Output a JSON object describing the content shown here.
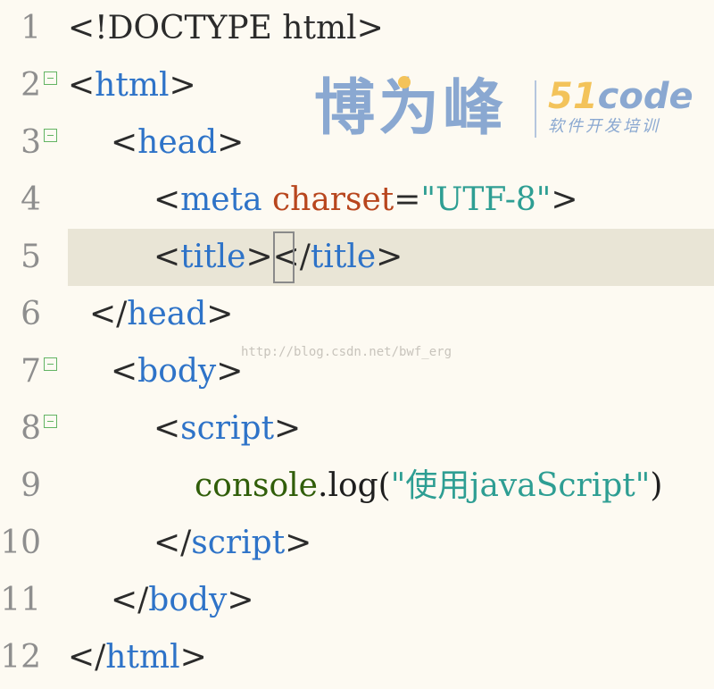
{
  "lines": [
    {
      "num": "1",
      "tokens": [
        "<!DOCTYPE",
        " html>"
      ]
    },
    {
      "num": "2",
      "tokens": [
        "<",
        "html",
        ">"
      ]
    },
    {
      "num": "3",
      "tokens": [
        "<",
        "head",
        ">"
      ]
    },
    {
      "num": "4",
      "tokens": [
        "<",
        "meta",
        " charset",
        "=",
        "\"UTF-8\"",
        ">"
      ]
    },
    {
      "num": "5",
      "tokens": [
        "<",
        "title",
        ">",
        "</",
        "title",
        ">"
      ]
    },
    {
      "num": "6",
      "tokens": [
        "</",
        "head",
        ">"
      ]
    },
    {
      "num": "7",
      "tokens": [
        "<",
        "body",
        ">"
      ]
    },
    {
      "num": "8",
      "tokens": [
        "<",
        "script",
        ">"
      ]
    },
    {
      "num": "9",
      "tokens": [
        "console",
        ".log(",
        "\"使用javaScript\"",
        ")"
      ]
    },
    {
      "num": "10",
      "tokens": [
        "</",
        "script",
        ">"
      ]
    },
    {
      "num": "11",
      "tokens": [
        "</",
        "body",
        ">"
      ]
    },
    {
      "num": "12",
      "tokens": [
        "</",
        "html",
        ">"
      ]
    }
  ],
  "logo": {
    "chinese": "博为峰",
    "code_num": "51",
    "code_text": "code",
    "subtitle": "软件开发培训"
  },
  "watermark": "http://blog.csdn.net/bwf_erg",
  "active_line": "5",
  "colors": {
    "background": "#fdfaf2",
    "active_line": "#e9e5d6",
    "tag": "#2e73c8",
    "attribute": "#b8461e",
    "string": "#2e9e93",
    "object": "#315e0a",
    "line_number": "#8e8e8e",
    "fold_marker": "#63b463",
    "logo": "#8aa8d1",
    "logo_accent": "#f3c35a"
  }
}
